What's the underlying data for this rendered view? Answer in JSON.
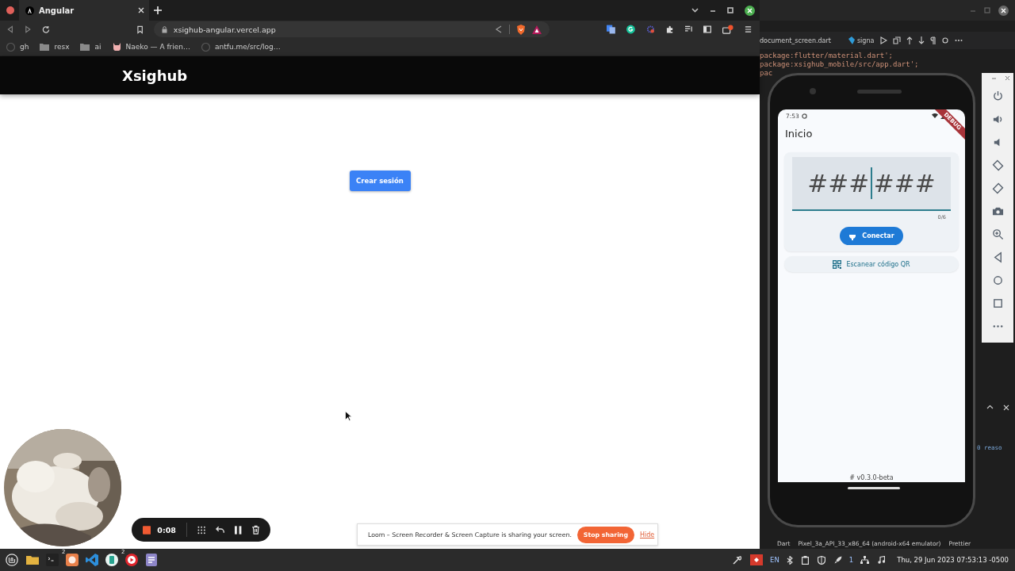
{
  "browser": {
    "tabs": [
      {
        "label": "Angular",
        "selected": true
      }
    ],
    "address": "xsighub-angular.vercel.app",
    "bookmarks": [
      {
        "label": "gh",
        "kind": "site"
      },
      {
        "label": "resx",
        "kind": "folder"
      },
      {
        "label": "ai",
        "kind": "folder"
      },
      {
        "label": "Naeko — A frien…",
        "kind": "cat"
      },
      {
        "label": "antfu.me/src/log…",
        "kind": "site"
      }
    ]
  },
  "page": {
    "brand": "Xsighub",
    "button": "Crear sesión"
  },
  "recorder": {
    "time": "0:08"
  },
  "share_notice": {
    "message": "Loom – Screen Recorder & Screen Capture is sharing your screen.",
    "stop": "Stop sharing",
    "hide": "Hide"
  },
  "editor": {
    "tabs": [
      {
        "label": "document_screen.dart"
      },
      {
        "label": "signa"
      }
    ],
    "code_lines": [
      "package:flutter/material.dart';",
      "package:xsighub_mobile/src/app.dart';",
      "pac"
    ],
    "panel_text": "0 reaso",
    "status_items": [
      "Dart",
      "Pixel_3a_API_33_x86_64 (android-x64 emulator)",
      "Prettier"
    ]
  },
  "phone": {
    "time": "7:53",
    "banner": "DEBUG",
    "title": "Inicio",
    "code_field": {
      "placeholder_left": "###",
      "placeholder_right": "###",
      "counter": "0/6"
    },
    "connect": "Conectar",
    "scan": "Escanear código QR",
    "version": "# v0.3.0-beta"
  },
  "taskbar": {
    "apps": [
      {
        "kind": "folder"
      },
      {
        "kind": "terminal"
      },
      {
        "kind": "firefox",
        "badge": "2"
      },
      {
        "kind": "vscode"
      },
      {
        "kind": "app"
      },
      {
        "kind": "recorder",
        "badge": "2"
      },
      {
        "kind": "notes"
      }
    ],
    "language": "EN",
    "workspace": "1",
    "clock": "Thu, 29 Jun 2023 07:53:13 -0500"
  }
}
